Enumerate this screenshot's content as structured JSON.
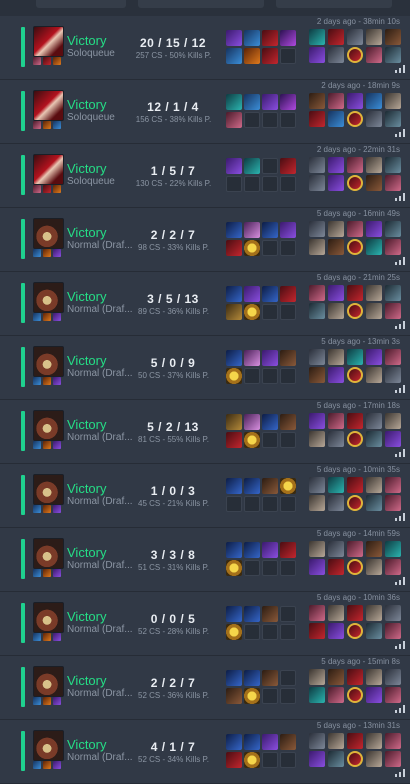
{
  "colors": {
    "victory": "#25de86",
    "accent": "#1fd18f",
    "background": "#2a313c",
    "row": "#313946"
  },
  "matches": [
    {
      "champion": "katarina-portrait-icon",
      "result": "Victory",
      "mode": "Soloqueue",
      "kda": "20 / 15 / 12",
      "cs": "257 CS - 50% Kills P.",
      "time": "2 days ago - 38min 10s",
      "items": [
        "violet",
        "blue",
        "crimson",
        "purple",
        "blue",
        "orange",
        "crimson",
        ""
      ],
      "players": [
        "teal",
        "crimson",
        "slate",
        "gray",
        "brown",
        "violet",
        "slate",
        "crimson",
        "rose",
        "steel"
      ],
      "spells": [
        "rose",
        "crimson",
        "orange"
      ]
    },
    {
      "champion": "katarina-portrait-icon",
      "result": "Victory",
      "mode": "Soloqueue",
      "kda": "12 / 1 / 4",
      "cs": "156 CS - 38% Kills P.",
      "time": "2 days ago - 18min 9s",
      "items": [
        "teal",
        "blue",
        "violet",
        "purple",
        "rose",
        "",
        "",
        ""
      ],
      "players": [
        "brown",
        "rose",
        "violet",
        "blue",
        "gray",
        "crimson",
        "blue",
        "crimson",
        "slate",
        "steel"
      ],
      "spells": [
        "rose",
        "orange",
        "blue"
      ]
    },
    {
      "champion": "katarina-portrait-icon",
      "result": "Victory",
      "mode": "Soloqueue",
      "kda": "1 / 5 / 7",
      "cs": "130 CS - 22% Kills P.",
      "time": "2 days ago - 22min 31s",
      "items": [
        "violet",
        "teal",
        "",
        "crimson",
        "",
        "",
        "",
        ""
      ],
      "players": [
        "slate",
        "violet",
        "rose",
        "gray",
        "steel",
        "slate",
        "violet",
        "crimson",
        "brown",
        "rose"
      ],
      "spells": [
        "rose",
        "crimson",
        "orange"
      ]
    },
    {
      "champion": "aurelion-portrait-icon",
      "result": "Victory",
      "mode": "Normal (Draf...",
      "kda": "2 / 2 / 7",
      "cs": "98 CS - 33% Kills P.",
      "time": "5 days ago - 16min 49s",
      "items": [
        "navy",
        "pink",
        "navy",
        "violet",
        "crimson",
        "gold",
        "",
        ""
      ],
      "players": [
        "slate",
        "gray",
        "rose",
        "violet",
        "steel",
        "gray",
        "brown",
        "crimson",
        "teal",
        "rose"
      ],
      "spells": [
        "blue",
        "orange",
        "violet"
      ]
    },
    {
      "champion": "aurelion-portrait-icon",
      "result": "Victory",
      "mode": "Normal (Draf...",
      "kda": "3 / 5 / 13",
      "cs": "89 CS - 36% Kills P.",
      "time": "5 days ago - 21min 25s",
      "items": [
        "navy",
        "violet",
        "navy",
        "crimson",
        "olive",
        "gold",
        "",
        ""
      ],
      "players": [
        "rose",
        "violet",
        "crimson",
        "gray",
        "steel",
        "steel",
        "gray",
        "crimson",
        "gray",
        "rose"
      ],
      "spells": [
        "blue",
        "orange",
        "violet"
      ]
    },
    {
      "champion": "aurelion-portrait-icon",
      "result": "Victory",
      "mode": "Normal (Draf...",
      "kda": "5 / 0 / 9",
      "cs": "50 CS - 37% Kills P.",
      "time": "5 days ago - 13min 3s",
      "items": [
        "navy",
        "pink",
        "violet",
        "brown",
        "gold",
        "",
        "",
        ""
      ],
      "players": [
        "slate",
        "gray",
        "teal",
        "violet",
        "rose",
        "brown",
        "violet",
        "crimson",
        "gray",
        "slate"
      ],
      "spells": [
        "blue",
        "orange",
        "violet"
      ]
    },
    {
      "champion": "aurelion-portrait-icon",
      "result": "Victory",
      "mode": "Normal (Draf...",
      "kda": "5 / 2 / 13",
      "cs": "81 CS - 55% Kills P.",
      "time": "5 days ago - 17min 18s",
      "items": [
        "olive",
        "pink",
        "navy",
        "brown",
        "crimson",
        "gold",
        "",
        ""
      ],
      "players": [
        "violet",
        "rose",
        "crimson",
        "slate",
        "gray",
        "gray",
        "slate",
        "crimson",
        "steel",
        "violet"
      ],
      "spells": [
        "blue",
        "orange",
        "violet"
      ]
    },
    {
      "champion": "aurelion-portrait-icon",
      "result": "Victory",
      "mode": "Normal (Draf...",
      "kda": "1 / 0 / 3",
      "cs": "45 CS - 21% Kills P.",
      "time": "5 days ago - 10min 35s",
      "items": [
        "navy",
        "navy",
        "brown",
        "gold",
        "",
        "",
        "",
        ""
      ],
      "players": [
        "slate",
        "teal",
        "crimson",
        "gray",
        "rose",
        "gray",
        "slate",
        "crimson",
        "steel",
        "rose"
      ],
      "spells": [
        "blue",
        "orange",
        "violet"
      ]
    },
    {
      "champion": "aurelion-portrait-icon",
      "result": "Victory",
      "mode": "Normal (Draf...",
      "kda": "3 / 3 / 8",
      "cs": "51 CS - 31% Kills P.",
      "time": "5 days ago - 14min 59s",
      "items": [
        "navy",
        "navy",
        "violet",
        "crimson",
        "gold",
        "",
        "",
        ""
      ],
      "players": [
        "gray",
        "slate",
        "rose",
        "brown",
        "teal",
        "violet",
        "crimson",
        "crimson",
        "gray",
        "rose"
      ],
      "spells": [
        "blue",
        "orange",
        "violet"
      ]
    },
    {
      "champion": "aurelion-portrait-icon",
      "result": "Victory",
      "mode": "Normal (Draf...",
      "kda": "0 / 0 / 5",
      "cs": "52 CS - 28% Kills P.",
      "time": "5 days ago - 10min 36s",
      "items": [
        "navy",
        "navy",
        "brown",
        "",
        "gold",
        "",
        "",
        ""
      ],
      "players": [
        "rose",
        "gray",
        "crimson",
        "gray",
        "slate",
        "crimson",
        "violet",
        "crimson",
        "steel",
        "rose"
      ],
      "spells": [
        "blue",
        "orange",
        "violet"
      ]
    },
    {
      "champion": "aurelion-portrait-icon",
      "result": "Victory",
      "mode": "Normal (Draf...",
      "kda": "2 / 2 / 7",
      "cs": "52 CS - 36% Kills P.",
      "time": "5 days ago - 15min 8s",
      "items": [
        "navy",
        "navy",
        "brown",
        "",
        "brown",
        "gold",
        "",
        ""
      ],
      "players": [
        "gray",
        "brown",
        "crimson",
        "gray",
        "slate",
        "teal",
        "rose",
        "crimson",
        "violet",
        "rose"
      ],
      "spells": [
        "blue",
        "orange",
        "violet"
      ]
    },
    {
      "champion": "aurelion-portrait-icon",
      "result": "Victory",
      "mode": "Normal (Draf...",
      "kda": "4 / 1 / 7",
      "cs": "52 CS - 34% Kills P.",
      "time": "5 days ago - 13min 31s",
      "items": [
        "navy",
        "navy",
        "violet",
        "brown",
        "crimson",
        "gold",
        "",
        ""
      ],
      "players": [
        "slate",
        "gray",
        "crimson",
        "gray",
        "rose",
        "violet",
        "steel",
        "crimson",
        "gray",
        "rose"
      ],
      "spells": [
        "blue",
        "orange",
        "violet"
      ]
    }
  ]
}
